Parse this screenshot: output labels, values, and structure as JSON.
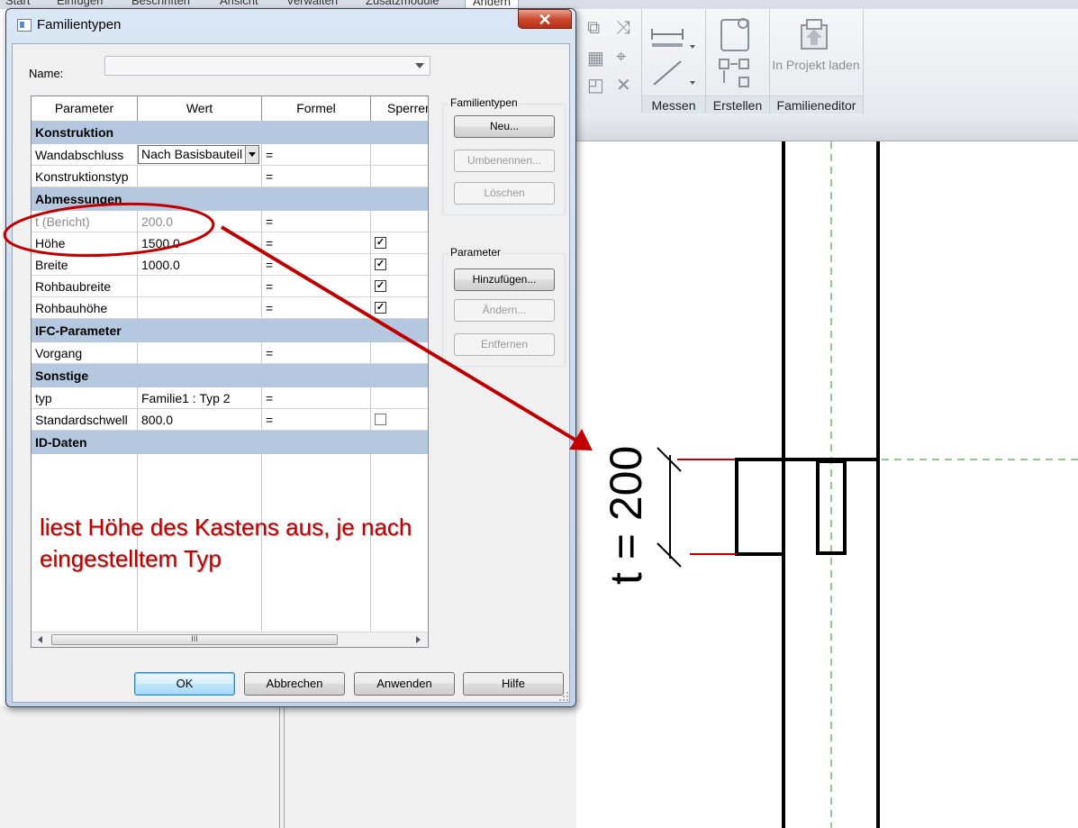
{
  "app": {
    "menu_tabs": [
      "Start",
      "Einfügen",
      "Beschriften",
      "Ansicht",
      "Verwalten",
      "Zusatzmodule",
      "Ändern"
    ],
    "ribbon": {
      "panels": [
        {
          "label": "Messen"
        },
        {
          "label": "Erstellen"
        },
        {
          "label": "Familieneditor"
        }
      ],
      "load_into_project_label": "In Projekt laden"
    }
  },
  "dialog": {
    "title": "Familientypen",
    "close_glyph": "✕",
    "name_label": "Name:",
    "name_value": "",
    "columns": [
      "Parameter",
      "Wert",
      "Formel",
      "Sperren"
    ],
    "groups": [
      {
        "label": "Konstruktion",
        "rows": [
          {
            "parameter": "Wandabschluss",
            "value": "Nach Basisbauteil",
            "formula": "=",
            "lock": "none",
            "dropdown": true
          },
          {
            "parameter": "Konstruktionstyp",
            "value": "",
            "formula": "=",
            "lock": "none"
          }
        ]
      },
      {
        "label": "Abmessungen",
        "rows": [
          {
            "parameter": "t (Bericht)",
            "value": "200.0",
            "formula": "=",
            "lock": "none",
            "greyed": true
          },
          {
            "parameter": "Höhe",
            "value": "1500.0",
            "formula": "=",
            "lock": "checked"
          },
          {
            "parameter": "Breite",
            "value": "1000.0",
            "formula": "=",
            "lock": "checked"
          },
          {
            "parameter": "Rohbaubreite",
            "value": "",
            "formula": "=",
            "lock": "checked"
          },
          {
            "parameter": "Rohbauhöhe",
            "value": "",
            "formula": "=",
            "lock": "checked"
          }
        ]
      },
      {
        "label": "IFC-Parameter",
        "rows": [
          {
            "parameter": "Vorgang",
            "value": "",
            "formula": "=",
            "lock": "none"
          }
        ]
      },
      {
        "label": "Sonstige",
        "rows": [
          {
            "parameter": "typ",
            "value": "Familie1 : Typ 2",
            "formula": "=",
            "lock": "none"
          },
          {
            "parameter": "Standardschwell",
            "value": "800.0",
            "formula": "=",
            "lock": "unchecked"
          }
        ]
      },
      {
        "label": "ID-Daten",
        "rows": []
      }
    ],
    "scroll_grip": "III",
    "family_types_group": {
      "label": "Familientypen",
      "buttons": [
        {
          "label": "Neu...",
          "enabled": true
        },
        {
          "label": "Umbenennen...",
          "enabled": false
        },
        {
          "label": "Löschen",
          "enabled": false
        }
      ]
    },
    "parameter_group": {
      "label": "Parameter",
      "buttons": [
        {
          "label": "Hinzufügen...",
          "enabled": true
        },
        {
          "label": "Ändern...",
          "enabled": false
        },
        {
          "label": "Entfernen",
          "enabled": false
        }
      ]
    },
    "footer_buttons": [
      "OK",
      "Abbrechen",
      "Anwenden",
      "Hilfe"
    ]
  },
  "annotation": {
    "text": "liest Höhe des Kastens aus, je nach eingestelltem Typ",
    "color": "#c00000"
  },
  "drawing": {
    "dimension_label": "t = 200",
    "line_color": "#000000",
    "reference_color": "#2e8b2e",
    "highlight_color": "#c00000"
  }
}
